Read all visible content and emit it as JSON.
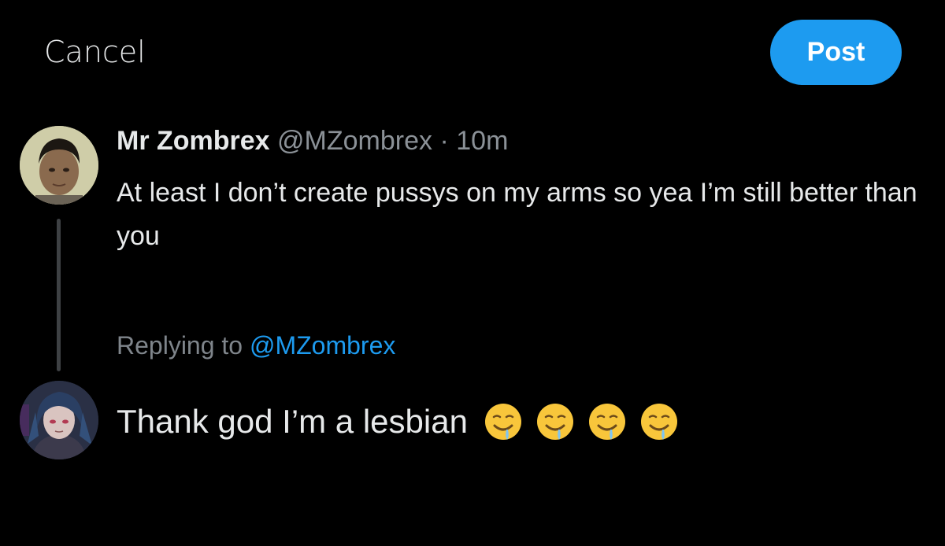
{
  "header": {
    "cancel_label": "Cancel",
    "post_label": "Post"
  },
  "quoted_post": {
    "display_name": "Mr Zombrex",
    "handle": "@MZombrex",
    "separator": "·",
    "time": "10m",
    "text": "At least I don’t create pussys on my arms so yea I’m still better than you"
  },
  "reply": {
    "replying_label": "Replying to",
    "replying_handle": "@MZombrex",
    "compose_text": "Thank god I’m a lesbian",
    "emojis": [
      "drooling-face",
      "drooling-face",
      "drooling-face",
      "drooling-face"
    ]
  },
  "colors": {
    "background": "#000000",
    "accent": "#1d9bf0",
    "primary_text": "#e7e9ea",
    "secondary_text": "#8b9197"
  }
}
